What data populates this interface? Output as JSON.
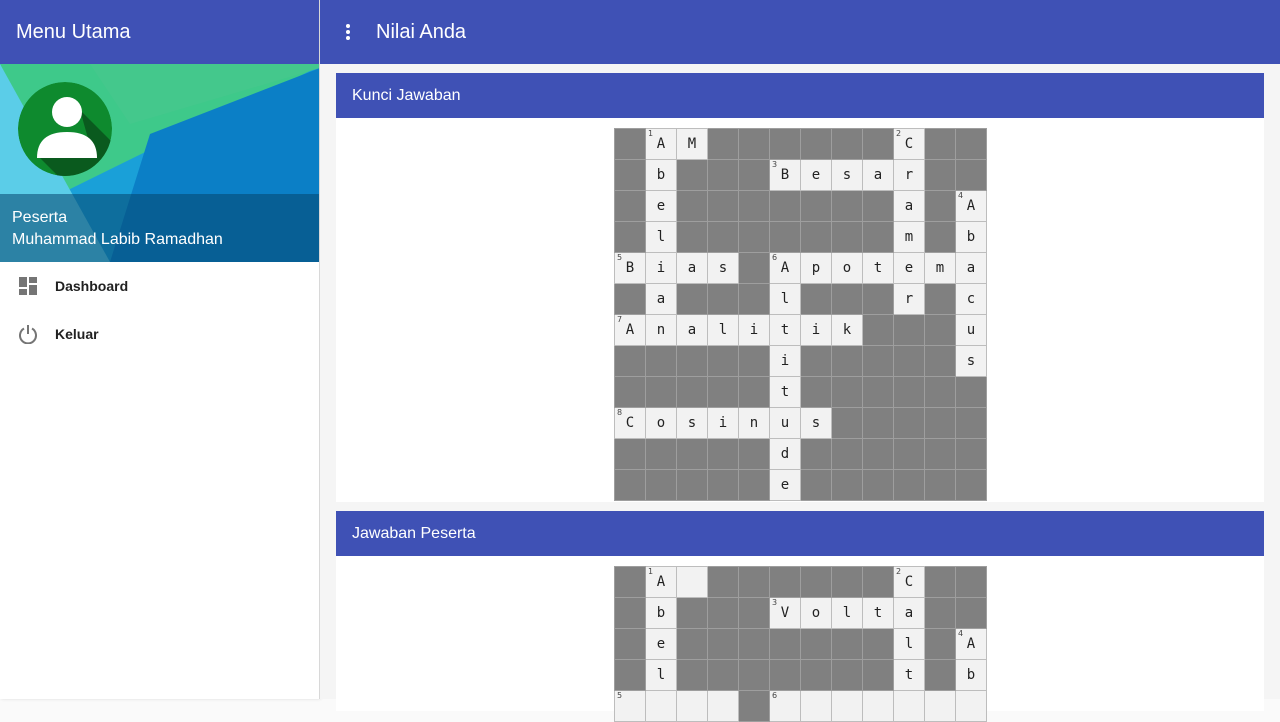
{
  "sidebar": {
    "title": "Menu Utama",
    "profile": {
      "role": "Peserta",
      "name": "Muhammad Labib Ramadhan"
    },
    "items": [
      {
        "label": "Dashboard",
        "icon": "dashboard-icon"
      },
      {
        "label": "Keluar",
        "icon": "power-icon"
      }
    ]
  },
  "header": {
    "title": "Nilai Anda",
    "menu_icon": "more-vert-icon"
  },
  "colors": {
    "primary": "#3f51b5",
    "block": "#808080",
    "cell": "#f2f2f2"
  },
  "sections": [
    {
      "title": "Kunci Jawaban",
      "grid": [
        [
          "#",
          "1A",
          "M",
          "#",
          "#",
          "#",
          "#",
          "#",
          "#",
          "2C",
          "#",
          "#"
        ],
        [
          "#",
          "b",
          "#",
          "#",
          "#",
          "3B",
          "e",
          "s",
          "a",
          "r",
          "#",
          "#"
        ],
        [
          "#",
          "e",
          "#",
          "#",
          "#",
          "#",
          "#",
          "#",
          "#",
          "a",
          "#",
          "4A"
        ],
        [
          "#",
          "l",
          "#",
          "#",
          "#",
          "#",
          "#",
          "#",
          "#",
          "m",
          "#",
          "b"
        ],
        [
          "5B",
          "i",
          "a",
          "s",
          "#",
          "6A",
          "p",
          "o",
          "t",
          "e",
          "m",
          "a"
        ],
        [
          "#",
          "a",
          "#",
          "#",
          "#",
          "l",
          "#",
          "#",
          "#",
          "r",
          "#",
          "c"
        ],
        [
          "7A",
          "n",
          "a",
          "l",
          "i",
          "t",
          "i",
          "k",
          "#",
          "#",
          "#",
          "u"
        ],
        [
          "#",
          "#",
          "#",
          "#",
          "#",
          "i",
          "#",
          "#",
          "#",
          "#",
          "#",
          "s"
        ],
        [
          "#",
          "#",
          "#",
          "#",
          "#",
          "t",
          "#",
          "#",
          "#",
          "#",
          "#",
          "#"
        ],
        [
          "8C",
          "o",
          "s",
          "i",
          "n",
          "u",
          "s",
          "#",
          "#",
          "#",
          "#",
          "#"
        ],
        [
          "#",
          "#",
          "#",
          "#",
          "#",
          "d",
          "#",
          "#",
          "#",
          "#",
          "#",
          "#"
        ],
        [
          "#",
          "#",
          "#",
          "#",
          "#",
          "e",
          "#",
          "#",
          "#",
          "#",
          "#",
          "#"
        ]
      ]
    },
    {
      "title": "Jawaban Peserta",
      "grid": [
        [
          "#",
          "1A",
          "",
          "#",
          "#",
          "#",
          "#",
          "#",
          "#",
          "2C",
          "#",
          "#"
        ],
        [
          "#",
          "b",
          "#",
          "#",
          "#",
          "3V",
          "o",
          "l",
          "t",
          "a",
          "#",
          "#"
        ],
        [
          "#",
          "e",
          "#",
          "#",
          "#",
          "#",
          "#",
          "#",
          "#",
          "l",
          "#",
          "4A"
        ],
        [
          "#",
          "l",
          "#",
          "#",
          "#",
          "#",
          "#",
          "#",
          "#",
          "t",
          "#",
          "b"
        ],
        [
          "5",
          "",
          "",
          "",
          "#",
          "6",
          "",
          "",
          "",
          "",
          "",
          ""
        ]
      ]
    }
  ]
}
